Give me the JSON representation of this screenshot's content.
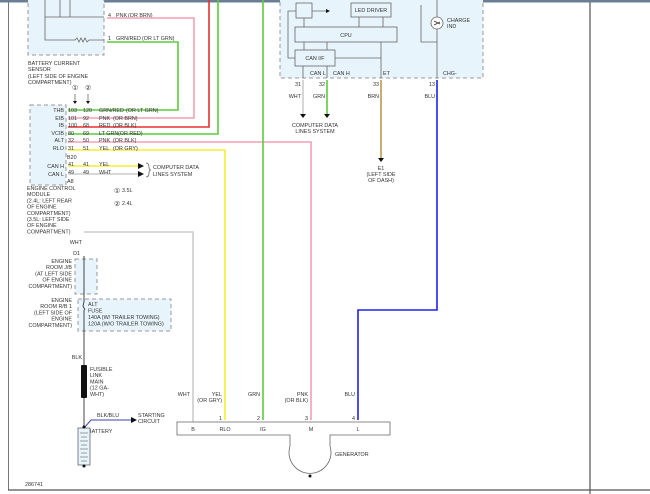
{
  "diagram_id": "286741",
  "colors": {
    "pink": "#f4a0b4",
    "red": "#e83030",
    "green": "#5ccc3c",
    "yellow": "#f4f030",
    "white_wire": "#cccccc",
    "brown": "#b89a50",
    "blue": "#2020f0",
    "black": "#111111",
    "box_fill": "#e8f4fc",
    "frame": "#6a7f96"
  },
  "battery_sensor": {
    "label": [
      "BATTERY CURRENT",
      "SENSOR",
      "(LEFT SIDE OF ENGINE",
      "COMPARTMENT)"
    ],
    "pins": [
      {
        "num": "4",
        "wire": "PNK",
        "alt": "(OR BRN)"
      },
      {
        "num": "1",
        "wire": "GRN/RED",
        "alt": "(OR LT GRN)"
      }
    ]
  },
  "legend": {
    "c1": "①",
    "c2": "②",
    "v1": "3.5L",
    "v2": "2.4L"
  },
  "ecm": {
    "label": [
      "ENGINE CONTROL",
      "MODULE",
      "(2.4L: LEFT REAR",
      "OF ENGINE",
      "COMPARTMENT)",
      "(3.5L: LEFT SIDE",
      "OF ENGINE",
      "COMPARTMENT)"
    ],
    "rows": [
      {
        "term": "THB",
        "p1": "103",
        "p2": "120",
        "wire": "GRN/RED",
        "alt": "(OR LT GRN)"
      },
      {
        "term": "EIB",
        "p1": "101",
        "p2": "92",
        "wire": "PNK",
        "alt": "(OR BRN)"
      },
      {
        "term": "IB",
        "p1": "100",
        "p2": "68",
        "wire": "RED",
        "alt": "(OR BLK)"
      },
      {
        "term": "VCIB",
        "p1": "80",
        "p2": "69",
        "wire": "LT GRN",
        "alt": "(OR RED)"
      },
      {
        "term": "ALT",
        "p1": "32",
        "p2": "50",
        "wire": "PNK",
        "alt": "(OR BLK)"
      },
      {
        "term": "RLO",
        "p1": "31",
        "p2": "51",
        "wire": "YEL",
        "alt": "(OR GRY)"
      }
    ],
    "connector_b": "B20",
    "connector_a": "A8",
    "can": [
      {
        "term": "CAN H",
        "p1": "41",
        "p2": "41",
        "wire": "YEL"
      },
      {
        "term": "CAN L",
        "p1": "49",
        "p2": "49",
        "wire": "WHT"
      }
    ],
    "can_dest": [
      "COMPUTER DATA",
      "LINES SYSTEM"
    ]
  },
  "combination_meter": {
    "blocks": {
      "led": "LED DRIVER",
      "cpu": "CPU",
      "canif": "CAN I/F",
      "charge": [
        "CHARGE",
        "IND"
      ]
    },
    "pins": [
      {
        "term": "CAN L",
        "num": "31",
        "wire": "WHT"
      },
      {
        "term": "CAN H",
        "num": "32",
        "wire": "GRN"
      },
      {
        "term": "ET",
        "num": "33",
        "wire": "BRN"
      },
      {
        "term": "CHG-",
        "num": "13",
        "wire": "BLU"
      }
    ],
    "can_dest": [
      "COMPUTER DATA",
      "LINES SYSTEM"
    ],
    "ground": [
      "E1",
      "(LEFT SIDE",
      "OF DASH)"
    ]
  },
  "power": {
    "wht": "WHT",
    "d1": "D1",
    "jb_label": [
      "ENGINE",
      "ROOM J/B",
      "(AT LEFT SIDE",
      "OF ENGINE",
      "COMPARTMENT)"
    ],
    "rb_label": [
      "ENGINE",
      "ROOM R/B 1",
      "(LEFT SIDE OF",
      "ENGINE",
      "COMPARTMENT)"
    ],
    "fuse": [
      "ALT",
      "FUSE",
      "140A    (W/ TRAILER TOWING)",
      "120A    (W/O TRAILER TOWING)"
    ],
    "blk": "BLK",
    "fusible": [
      "FUSIBLE",
      "LINK",
      "MAIN",
      "(12 GA-",
      "WHT)"
    ],
    "start_wire": "BLK/BLU",
    "start_dest": [
      "STARTING",
      "CIRCUIT"
    ],
    "battery": "BATTERY"
  },
  "generator": {
    "label": "GENERATOR",
    "terminals": [
      {
        "term": "B",
        "num": "",
        "wire": "WHT",
        "alt": ""
      },
      {
        "term": "RLO",
        "num": "1",
        "wire": "YEL",
        "alt": "(OR GRY)"
      },
      {
        "term": "IG",
        "num": "2",
        "wire": "GRN",
        "alt": ""
      },
      {
        "term": "M",
        "num": "3",
        "wire": "PNK",
        "alt": "(OR BLK)"
      },
      {
        "term": "L",
        "num": "4",
        "wire": "BLU",
        "alt": ""
      }
    ]
  }
}
